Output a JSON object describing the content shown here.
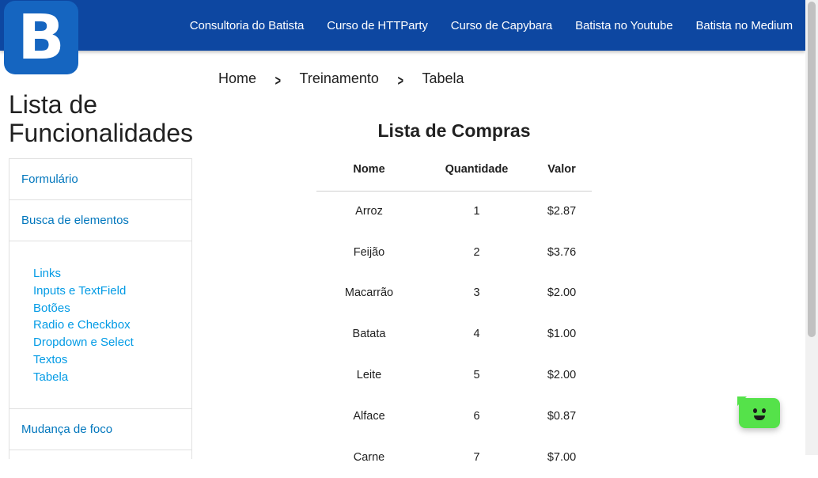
{
  "logo": {
    "letter": "B"
  },
  "nav": {
    "links": [
      "Consultoria do Batista",
      "Curso de HTTParty",
      "Curso de Capybara",
      "Batista no Youtube",
      "Batista no Medium"
    ]
  },
  "breadcrumb": {
    "home": "Home",
    "level2": "Treinamento",
    "level3": "Tabela"
  },
  "sidebar": {
    "title_line1": "Lista de",
    "title_line2": "Funcionalidades",
    "items": [
      "Formulário",
      "Busca de elementos"
    ],
    "subitems": [
      "Links",
      "Inputs e TextField",
      "Botões",
      "Radio e Checkbox",
      "Dropdown e Select",
      "Textos",
      "Tabela"
    ],
    "after": "Mudança de foco"
  },
  "table": {
    "title": "Lista de Compras",
    "headers": [
      "Nome",
      "Quantidade",
      "Valor"
    ],
    "rows": [
      [
        "Arroz",
        "1",
        "$2.87"
      ],
      [
        "Feijão",
        "2",
        "$3.76"
      ],
      [
        "Macarrão",
        "3",
        "$2.00"
      ],
      [
        "Batata",
        "4",
        "$1.00"
      ],
      [
        "Leite",
        "5",
        "$2.00"
      ],
      [
        "Alface",
        "6",
        "$0.87"
      ],
      [
        "Carne",
        "7",
        "$7.00"
      ]
    ]
  }
}
